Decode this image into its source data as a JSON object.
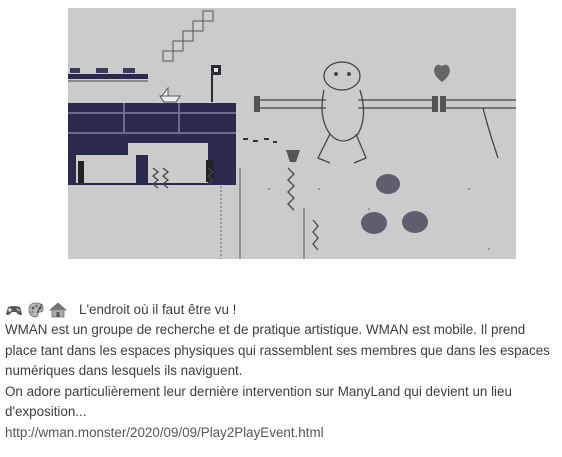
{
  "preview": {
    "image_name": "manyland-pixel-art-scene"
  },
  "post": {
    "emojis": [
      "game-controller-icon",
      "palette-icon",
      "house-icon"
    ],
    "headline": "L'endroit où il faut être vu !",
    "paragraph1": "WMAN est un groupe de recherche et de pratique artistique. WMAN est mobile. Il prend place tant dans les espaces physiques qui rassemblent ses membres que dans les espaces numériques dans lesquels ils naviguent.",
    "paragraph2": "On adore particulièrement leur dernière intervention sur ManyLand qui devient un lieu d'exposition...",
    "link": "http://wman.monster/2020/09/09/Play2PlayEvent.html"
  }
}
